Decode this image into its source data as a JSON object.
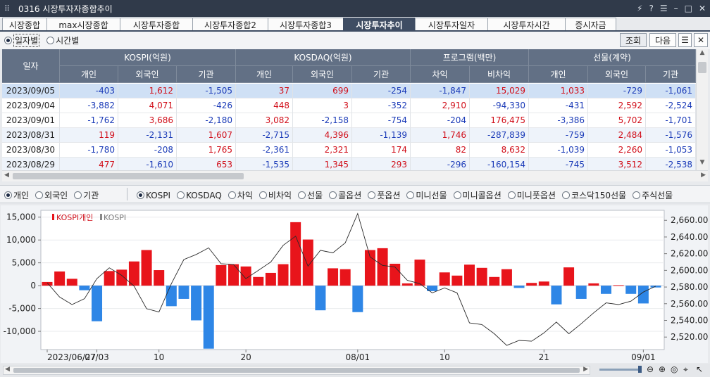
{
  "window": {
    "title": "0316 시장투자자종합추이",
    "controls": [
      "⚡",
      "?",
      "☰",
      "–",
      "□",
      "✕"
    ]
  },
  "tabs": [
    {
      "label": "시장종합",
      "w": 64
    },
    {
      "label": "max시장종합",
      "w": 105
    },
    {
      "label": "시장투자종합",
      "w": 104
    },
    {
      "label": "시장투자종합2",
      "w": 108
    },
    {
      "label": "시장투자종합3",
      "w": 108
    },
    {
      "label": "시장투자추이",
      "w": 103,
      "active": true
    },
    {
      "label": "시장투자일자",
      "w": 104
    },
    {
      "label": "시장투자시간",
      "w": 111
    },
    {
      "label": "증시자금",
      "w": 73
    }
  ],
  "period": {
    "options": [
      "일자별",
      "시간별"
    ],
    "selected": 0
  },
  "buttons": {
    "query": "조회",
    "next": "다음"
  },
  "table": {
    "corner": "일자",
    "groups": [
      "KOSPI(억원)",
      "KOSDAQ(억원)",
      "프로그램(백만)",
      "선물(계약)"
    ],
    "subs": [
      "개인",
      "외국인",
      "기관",
      "개인",
      "외국인",
      "기관",
      "차익",
      "비차익",
      "개인",
      "외국인",
      "기관"
    ],
    "rows": [
      {
        "date": "2023/09/05",
        "v": [
          "-403",
          "1,612",
          "-1,505",
          "37",
          "699",
          "-254",
          "-1,847",
          "15,029",
          "1,033",
          "-729",
          "-1,061"
        ]
      },
      {
        "date": "2023/09/04",
        "v": [
          "-3,882",
          "4,071",
          "-426",
          "448",
          "3",
          "-352",
          "2,910",
          "-94,330",
          "-431",
          "2,592",
          "-2,524"
        ]
      },
      {
        "date": "2023/09/01",
        "v": [
          "-1,762",
          "3,686",
          "-2,180",
          "3,082",
          "-2,158",
          "-754",
          "-204",
          "176,475",
          "-3,386",
          "5,702",
          "-1,701"
        ]
      },
      {
        "date": "2023/08/31",
        "v": [
          "119",
          "-2,131",
          "1,607",
          "-2,715",
          "4,396",
          "-1,139",
          "1,746",
          "-287,839",
          "-759",
          "2,484",
          "-1,576"
        ]
      },
      {
        "date": "2023/08/30",
        "v": [
          "-1,780",
          "-208",
          "1,765",
          "-2,361",
          "2,321",
          "174",
          "82",
          "8,632",
          "-1,039",
          "2,260",
          "-1,053"
        ]
      },
      {
        "date": "2023/08/29",
        "v": [
          "477",
          "-1,610",
          "653",
          "-1,535",
          "1,345",
          "293",
          "-296",
          "-160,154",
          "-745",
          "3,512",
          "-2,538"
        ]
      }
    ]
  },
  "investor_filter": {
    "options": [
      "개인",
      "외국인",
      "기관"
    ],
    "selected": 0
  },
  "market_filter": {
    "options": [
      "KOSPI",
      "KOSDAQ",
      "차익",
      "비차익",
      "선물",
      "콜옵션",
      "풋옵션",
      "미니선물",
      "미니콜옵션",
      "미니풋옵션",
      "코스닥150선물",
      "주식선물"
    ],
    "selected": 0
  },
  "colors": {
    "positive": "#e8141b",
    "negative": "#2e86e6",
    "header": "#627085",
    "selected_row": "#cfe0f5"
  },
  "chart_data": {
    "type": "bar",
    "legend": [
      {
        "name": "KOSPI개인",
        "color": "#e8141b"
      },
      {
        "name": "KOSPI",
        "color": "#888888"
      }
    ],
    "dates": [
      "2023/06/27",
      "06/28",
      "06/29",
      "06/30",
      "07/03",
      "07/04",
      "07/05",
      "07/06",
      "07/07",
      "07/10",
      "07/11",
      "07/12",
      "07/13",
      "07/14",
      "07/17",
      "07/18",
      "07/19",
      "07/20",
      "07/21",
      "07/24",
      "07/25",
      "07/26",
      "07/27",
      "07/28",
      "07/31",
      "08/01",
      "08/02",
      "08/03",
      "08/04",
      "08/07",
      "08/08",
      "08/09",
      "08/10",
      "08/11",
      "08/14",
      "08/16",
      "08/17",
      "08/18",
      "08/21",
      "08/22",
      "08/23",
      "08/24",
      "08/25",
      "08/28",
      "08/29",
      "08/30",
      "08/31",
      "09/01",
      "09/04",
      "09/05"
    ],
    "series": [
      {
        "name": "KOSPI개인",
        "axis": "left",
        "values": [
          800,
          3100,
          1500,
          -1000,
          -7800,
          3200,
          3500,
          5300,
          7800,
          3400,
          -4500,
          -2900,
          -7600,
          -13800,
          4500,
          4700,
          4200,
          1900,
          2800,
          4700,
          13900,
          10100,
          -5400,
          3800,
          3600,
          -5800,
          7800,
          8200,
          4800,
          500,
          5700,
          -1200,
          2900,
          2200,
          4600,
          3900,
          1900,
          3600,
          -500,
          600,
          900,
          -4100,
          4000,
          -2900,
          500,
          -1800,
          100,
          -1800,
          -3900,
          -400
        ]
      },
      {
        "name": "KOSPI",
        "axis": "right",
        "values": [
          2585,
          2568,
          2559,
          2566,
          2590,
          2603,
          2594,
          2581,
          2554,
          2550,
          2584,
          2613,
          2619,
          2627,
          2608,
          2607,
          2590,
          2600,
          2610,
          2630,
          2641,
          2605,
          2624,
          2621,
          2633,
          2668,
          2616,
          2606,
          2604,
          2588,
          2584,
          2573,
          2579,
          2573,
          2537,
          2535,
          2524,
          2510,
          2516,
          2515,
          2525,
          2538,
          2524,
          2536,
          2549,
          2561,
          2559,
          2563,
          2574,
          2581
        ]
      }
    ],
    "y_left": {
      "ticks": [
        "15,000",
        "10,000",
        "5,000",
        "0",
        "-5,000",
        "-10,000"
      ],
      "min": -14000,
      "max": 16500
    },
    "y_right": {
      "ticks": [
        "2,660.00",
        "2,640.00",
        "2,620.00",
        "2,600.00",
        "2,580.00",
        "2,560.00",
        "2,540.00",
        "2,520.00"
      ],
      "min": 2505,
      "max": 2672
    },
    "x_labels": [
      "2023/06/27",
      "07/03",
      "10",
      "20",
      "08/01",
      "10",
      "21",
      "09/01"
    ]
  }
}
